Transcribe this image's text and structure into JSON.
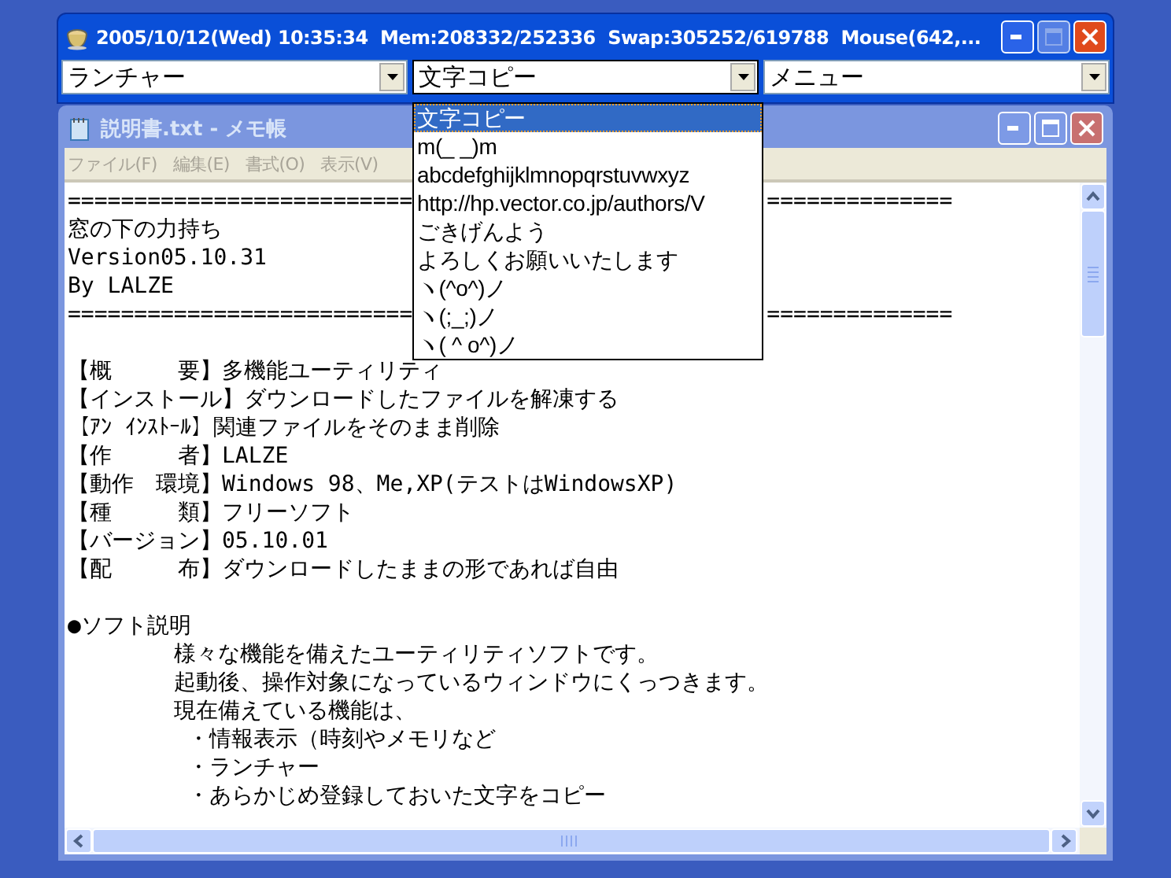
{
  "top_window": {
    "title": "2005/10/12(Wed) 10:35:34  Mem:208332/252336  Swap:305252/619788  Mouse(642,...",
    "maximize_disabled": true,
    "combos": [
      {
        "value": "ランチャー",
        "open": false
      },
      {
        "value": "文字コピー",
        "open": true
      },
      {
        "value": "メニュー",
        "open": false
      }
    ]
  },
  "dropdown": {
    "items": [
      {
        "label": "文字コピー",
        "selected": true
      },
      {
        "label": "m(_ _)m",
        "selected": false
      },
      {
        "label": "abcdefghijklmnopqrstuvwxyz",
        "selected": false
      },
      {
        "label": "http://hp.vector.co.jp/authors/V",
        "selected": false
      },
      {
        "label": "ごきげんよう",
        "selected": false
      },
      {
        "label": "よろしくお願いいたします",
        "selected": false
      },
      {
        "label": "ヽ(^o^)ノ",
        "selected": false
      },
      {
        "label": "ヽ(;_;)ノ",
        "selected": false
      },
      {
        "label": "ヽ( ^ o^)ノ",
        "selected": false
      }
    ]
  },
  "notepad": {
    "title": "説明書.txt - メモ帳",
    "active": false,
    "menu": [
      "ファイル(F)",
      "編集(E)",
      "書式(O)",
      "表示(V)"
    ],
    "blocks": [
      [
        [
          "==========================",
          "=============="
        ],
        "窓の下の力持ち",
        "Version05.10.31",
        "By LALZE",
        [
          "==========================",
          "=============="
        ]
      ],
      [
        "【概　　　要】多機能ユーティリティ",
        "【インストール】ダウンロードしたファイルを解凍する",
        "【ｱﾝ ｲﾝｽﾄｰﾙ】関連ファイルをそのまま削除",
        "【作　　　者】LALZE",
        "【動作　環境】Windows 98、Me,XP(テストはWindowsXP)",
        "【種　　　類】フリーソフト",
        "【バージョン】05.10.01",
        "【配　　　布】ダウンロードしたままの形であれば自由"
      ],
      [
        "●ソフト説明",
        "        様々な機能を備えたユーティリティソフトです。",
        "        起動後、操作対象になっているウィンドウにくっつきます。",
        "        現在備えている機能は、",
        "         ・情報表示（時刻やメモリなど",
        "         ・ランチャー",
        "         ・あらかじめ登録しておいた文字をコピー"
      ]
    ]
  }
}
